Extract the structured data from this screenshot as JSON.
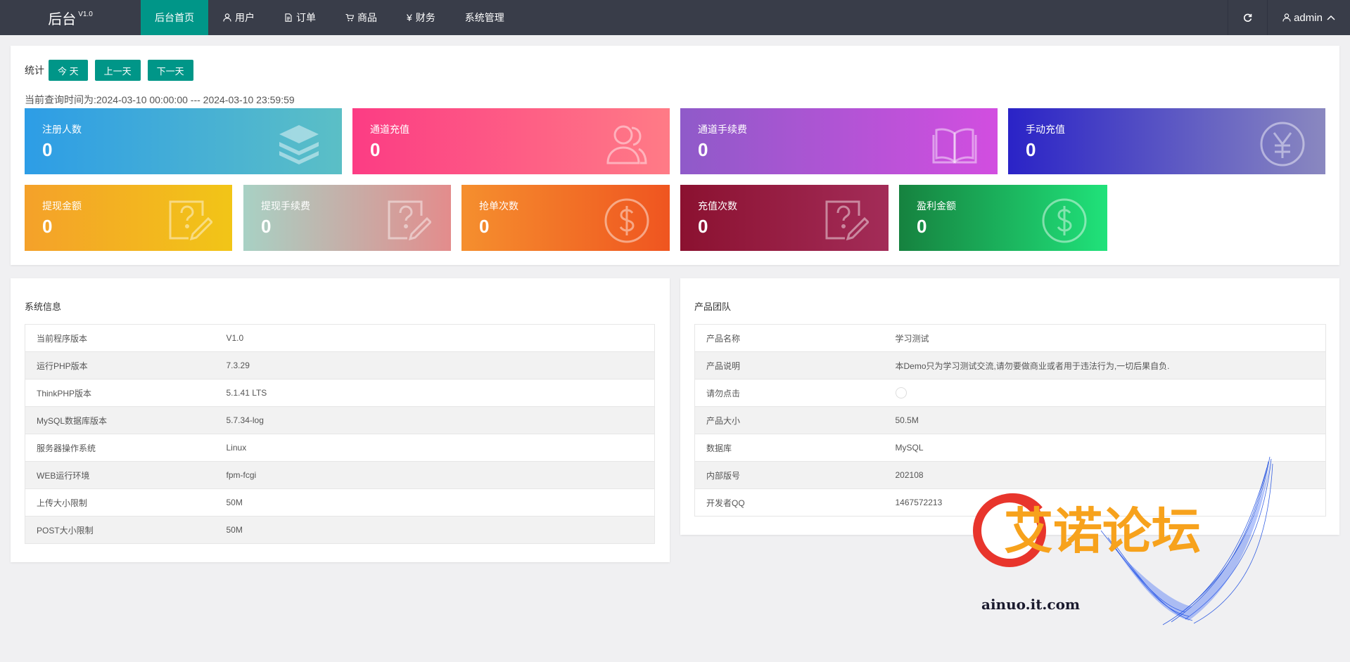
{
  "header": {
    "logo": "后台",
    "version": "V1.0",
    "nav": [
      {
        "label": "后台首页",
        "icon": "",
        "active": true
      },
      {
        "label": "用户",
        "icon": "user-icon",
        "active": false
      },
      {
        "label": "订单",
        "icon": "document-icon",
        "active": false
      },
      {
        "label": "商品",
        "icon": "cart-icon",
        "active": false
      },
      {
        "label": "财务",
        "icon": "yen-icon",
        "active": false
      },
      {
        "label": "系统管理",
        "icon": "",
        "active": false
      }
    ],
    "user": "admin"
  },
  "stats": {
    "label": "统计",
    "buttons": [
      "今 天",
      "上一天",
      "下一天"
    ],
    "query_time": "当前查询时间为:2024-03-10 00:00:00 --- 2024-03-10 23:59:59",
    "tiles": [
      {
        "label": "注册人数",
        "value": "0",
        "icon": "layers-icon"
      },
      {
        "label": "通道充值",
        "value": "0",
        "icon": "users-icon"
      },
      {
        "label": "通道手续费",
        "value": "0",
        "icon": "book-icon"
      },
      {
        "label": "手动充值",
        "value": "0",
        "icon": "yen-circle-icon"
      },
      {
        "label": "提现金额",
        "value": "0",
        "icon": "question-edit-icon"
      },
      {
        "label": "提现手续费",
        "value": "0",
        "icon": "question-edit-icon"
      },
      {
        "label": "抢单次数",
        "value": "0",
        "icon": "dollar-circle-icon"
      },
      {
        "label": "充值次数",
        "value": "0",
        "icon": "question-edit-icon"
      },
      {
        "label": "盈利金额",
        "value": "0",
        "icon": "dollar-circle-icon"
      }
    ]
  },
  "system": {
    "title": "系统信息",
    "rows": [
      {
        "k": "当前程序版本",
        "v": "V1.0"
      },
      {
        "k": "运行PHP版本",
        "v": "7.3.29"
      },
      {
        "k": "ThinkPHP版本",
        "v": "5.1.41 LTS"
      },
      {
        "k": "MySQL数据库版本",
        "v": "5.7.34-log"
      },
      {
        "k": "服务器操作系统",
        "v": "Linux"
      },
      {
        "k": "WEB运行环境",
        "v": "fpm-fcgi"
      },
      {
        "k": "上传大小限制",
        "v": "50M"
      },
      {
        "k": "POST大小限制",
        "v": "50M"
      }
    ]
  },
  "team": {
    "title": "产品团队",
    "rows": [
      {
        "k": "产品名称",
        "v": "学习测试"
      },
      {
        "k": "产品说明",
        "v": "本Demo只为学习测试交流,请勿要做商业或者用于违法行为,一切后果自负."
      },
      {
        "k": "请勿点击",
        "v": ""
      },
      {
        "k": "产品大小",
        "v": "50.5M"
      },
      {
        "k": "数据库",
        "v": "MySQL"
      },
      {
        "k": "内部版号",
        "v": "202108"
      },
      {
        "k": "开发者QQ",
        "v": "1467572213"
      }
    ]
  },
  "watermark": {
    "text": "艾诺论坛",
    "site": "ainuo.it.com"
  }
}
